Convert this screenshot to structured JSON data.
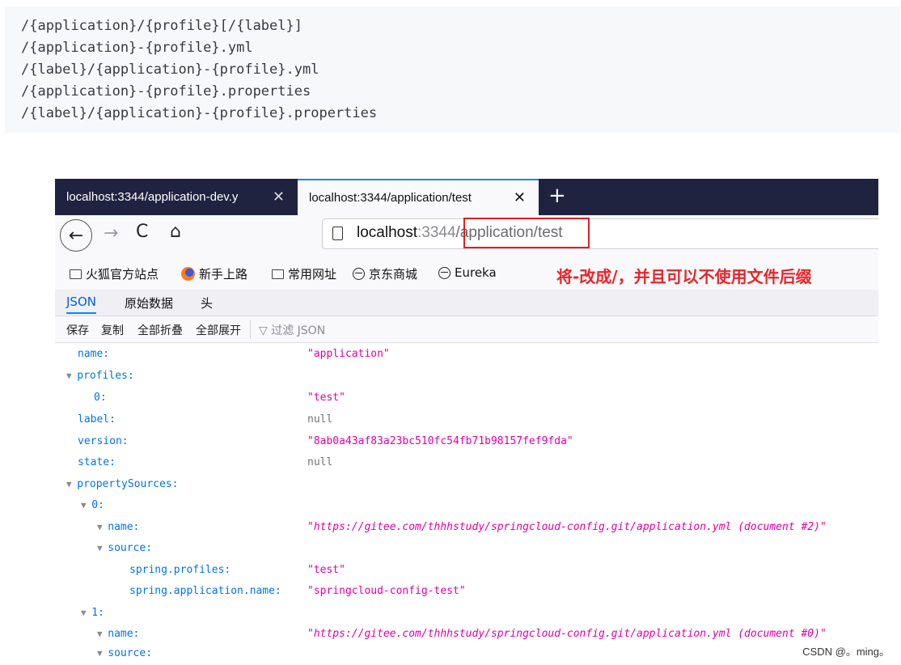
{
  "code_lines": [
    "/{application}/{profile}[/{label}]",
    "/{application}-{profile}.yml",
    "/{label}/{application}-{profile}.yml",
    "/{application}-{profile}.properties",
    "/{label}/{application}-{profile}.properties"
  ],
  "browser": {
    "tabs": [
      {
        "title": "localhost:3344/application-dev.y",
        "close": "✕"
      },
      {
        "title": "localhost:3344/application/test",
        "close": "✕"
      }
    ],
    "new_tab": "+",
    "nav": {
      "back": "←",
      "forward": "→",
      "reload": "C",
      "home": "⌂"
    },
    "url": {
      "host": "localhost",
      "port": ":3344",
      "path": "/application/test"
    },
    "bookmarks": [
      {
        "icon": "folder-icon",
        "label": "火狐官方站点"
      },
      {
        "icon": "firefox-icon",
        "label": "新手上路"
      },
      {
        "icon": "folder-icon",
        "label": "常用网址"
      },
      {
        "icon": "globe-icon",
        "label": "京东商城"
      },
      {
        "icon": "globe-icon",
        "label": "Eureka"
      }
    ],
    "annotation": "将-改成/，并且可以不使用文件后缀",
    "viewer_tabs": [
      "JSON",
      "原始数据",
      "头"
    ],
    "toolbar": {
      "save": "保存",
      "copy": "复制",
      "collapse_all": "全部折叠",
      "expand_all": "全部展开",
      "filter": "过滤 JSON"
    }
  },
  "json_rows": [
    {
      "key": "name:",
      "value": "\"application\"",
      "type": "str"
    },
    {
      "key": "profiles:",
      "value": "",
      "type": "obj"
    },
    {
      "key": "0:",
      "value": "\"test\"",
      "type": "str"
    },
    {
      "key": "label:",
      "value": "null",
      "type": "null"
    },
    {
      "key": "version:",
      "value": "\"8ab0a43af83a23bc510fc54fb71b98157fef9fda\"",
      "type": "str"
    },
    {
      "key": "state:",
      "value": "null",
      "type": "null"
    },
    {
      "key": "propertySources:",
      "value": "",
      "type": "obj"
    },
    {
      "key": "0:",
      "value": "",
      "type": "obj"
    },
    {
      "key": "name:",
      "value": "\"https://gitee.com/thhhstudy/springcloud-config.git/application.yml (document #2)\"",
      "type": "url"
    },
    {
      "key": "source:",
      "value": "",
      "type": "obj"
    },
    {
      "key": "spring.profiles:",
      "value": "\"test\"",
      "type": "str"
    },
    {
      "key": "spring.application.name:",
      "value": "\"springcloud-config-test\"",
      "type": "str"
    },
    {
      "key": "1:",
      "value": "",
      "type": "obj"
    },
    {
      "key": "name:",
      "value": "\"https://gitee.com/thhhstudy/springcloud-config.git/application.yml (document #0)\"",
      "type": "url"
    },
    {
      "key": "source:",
      "value": "",
      "type": "obj"
    }
  ],
  "watermark": "CSDN @。ming。"
}
